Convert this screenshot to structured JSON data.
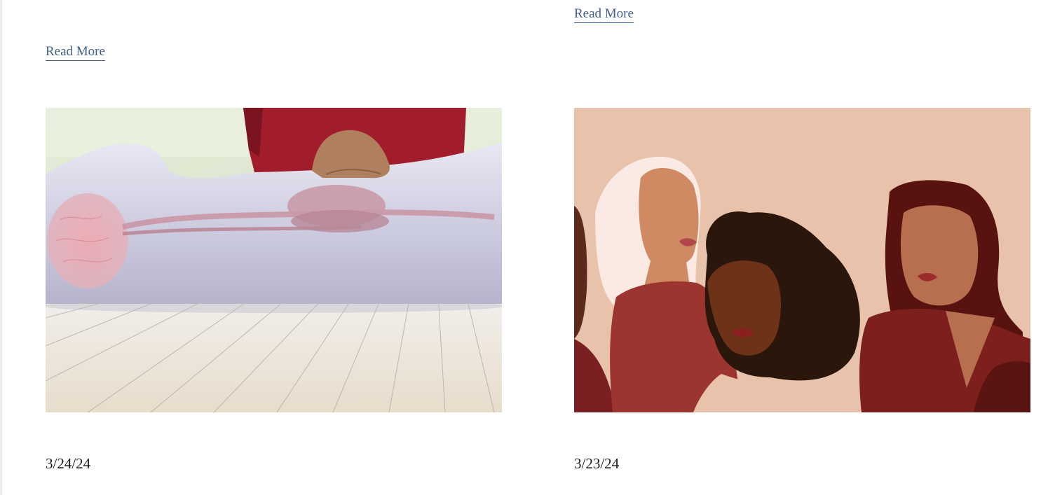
{
  "posts": [
    {
      "read_more": "Read More",
      "date": "3/24/24",
      "image_subject": "cpr-anatomy-illustration"
    },
    {
      "read_more": "Read More",
      "date": "3/23/24",
      "image_subject": "women-faces-illustration"
    }
  ]
}
